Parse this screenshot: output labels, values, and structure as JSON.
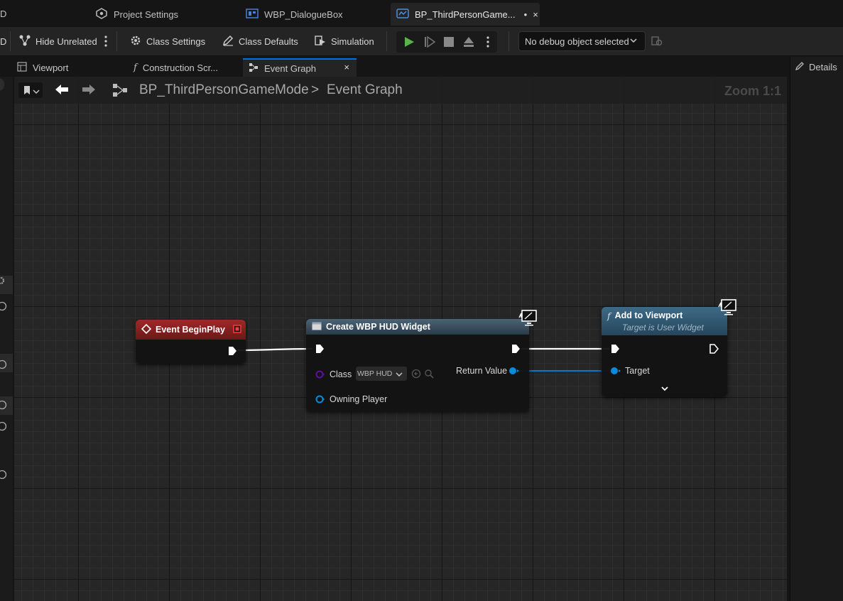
{
  "doc_tabs": [
    {
      "label": "Project Settings"
    },
    {
      "label": "WBP_DialogueBox"
    },
    {
      "label": "BP_ThirdPersonGame..."
    }
  ],
  "toolbar": {
    "left_partial": "D",
    "hide_unrelated": "Hide Unrelated",
    "class_settings": "Class Settings",
    "class_defaults": "Class Defaults",
    "simulation": "Simulation",
    "debug_object": "No debug object selected"
  },
  "sub_tabs": [
    {
      "label": "Viewport"
    },
    {
      "label": "Construction Scr..."
    },
    {
      "label": "Event Graph"
    }
  ],
  "details": {
    "label": "Details"
  },
  "breadcrumb": {
    "blueprint": "BP_ThirdPersonGameMode",
    "separator": ">",
    "graph": "Event Graph"
  },
  "zoom": "Zoom 1:1",
  "nodes": {
    "begin_play": {
      "title": "Event BeginPlay",
      "color": "#7a1f1f"
    },
    "create_widget": {
      "title": "Create WBP HUD Widget",
      "class_label": "Class",
      "class_value": "WBP HUD",
      "owning_player": "Owning Player",
      "return_value": "Return Value"
    },
    "add_to_viewport": {
      "title": "Add to Viewport",
      "subtitle": "Target is User Widget",
      "target": "Target"
    }
  },
  "colors": {
    "exec_wire": "#ffffff",
    "object_wire": "#0a78c8",
    "accent": "#0070e0"
  }
}
